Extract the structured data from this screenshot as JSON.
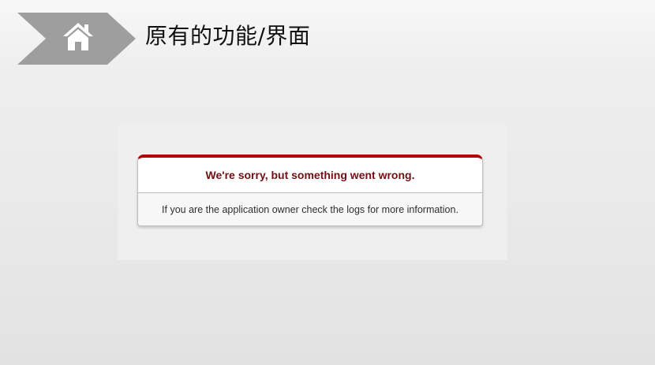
{
  "slide": {
    "title": "原有的功能/界面"
  },
  "icons": {
    "home": "home-icon"
  },
  "colors": {
    "chevron": "#9e9e9e",
    "dialog_accent": "#b00100",
    "error_heading_text": "#730e15",
    "body_text": "#2e2f30"
  },
  "error_page": {
    "heading": "We're sorry, but something went wrong.",
    "message": "If you are the application owner check the logs for more information."
  }
}
